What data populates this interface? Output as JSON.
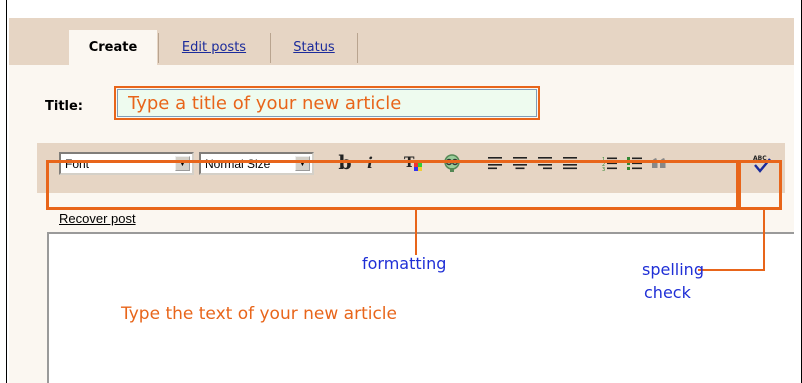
{
  "tabs": [
    {
      "label": "Create",
      "active": true
    },
    {
      "label": "Edit posts",
      "active": false
    },
    {
      "label": "Status",
      "active": false
    }
  ],
  "title_field": {
    "label": "Title:",
    "placeholder": "Type a title of your new article"
  },
  "toolbar": {
    "font_select": "Font",
    "size_select": "Normal Size",
    "bold_label": "b",
    "italic_label": "i",
    "icons": [
      "text-color-icon",
      "link-icon",
      "align-left-icon",
      "align-center-icon",
      "align-right-icon",
      "align-justify-icon",
      "numbered-list-icon",
      "bulleted-list-icon",
      "blockquote-icon",
      "spellcheck-icon"
    ]
  },
  "recover_link": "Recover post",
  "editor": {
    "hint": "Type the text of your new article"
  },
  "annotations": {
    "formatting": "formatting",
    "spelling_line1": "spelling",
    "spelling_line2": "check"
  },
  "colors": {
    "annotation_orange": "#e8651a",
    "annotation_blue": "#1f2fd6",
    "tab_bar": "#e6d5c4",
    "link": "#1b2b9b"
  }
}
